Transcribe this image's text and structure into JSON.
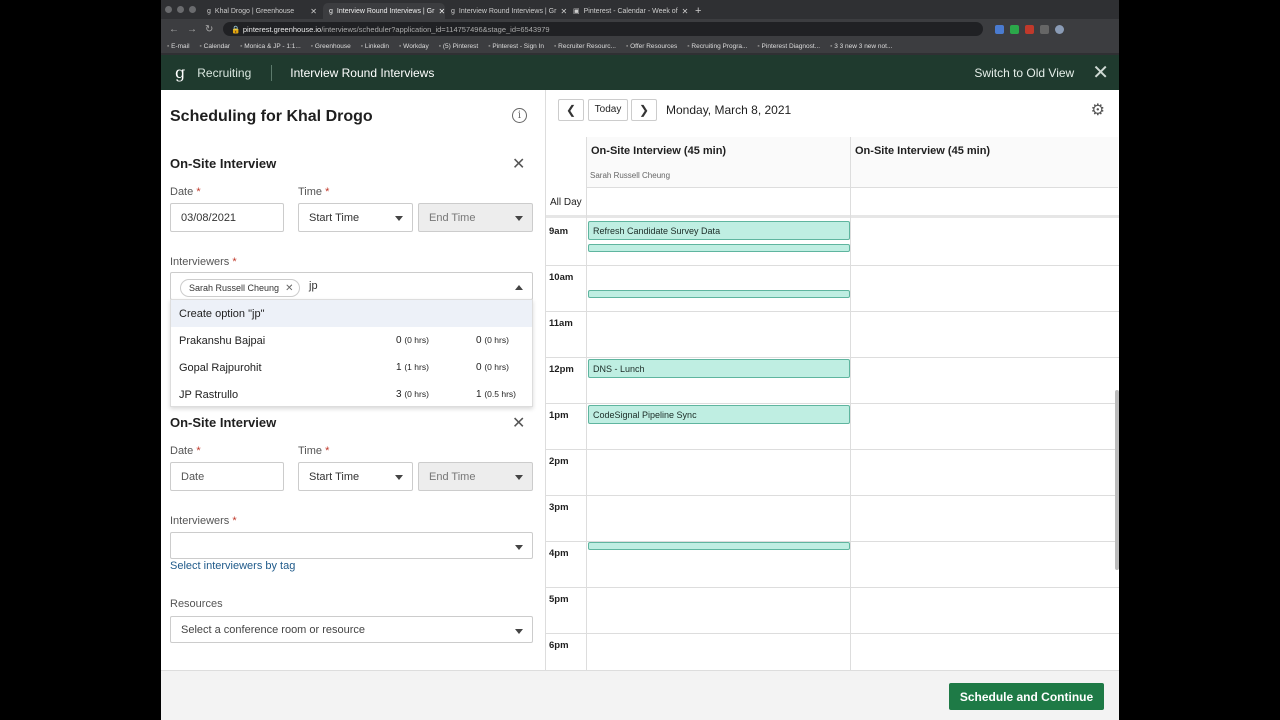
{
  "browser": {
    "tabs": [
      {
        "label": "Khal Drogo | Greenhouse",
        "active": false
      },
      {
        "label": "Interview Round Interviews | Gr",
        "active": true
      },
      {
        "label": "Interview Round Interviews | Gr",
        "active": false
      },
      {
        "label": "Pinterest - Calendar - Week of",
        "active": false
      }
    ],
    "url_host": "pinterest.greenhouse.io",
    "url_path": "/interviews/scheduler?application_id=114757496&stage_id=6543979",
    "bookmarks": [
      "E-mail",
      "Calendar",
      "Monica & JP - 1:1...",
      "Greenhouse",
      "Linkedin",
      "Workday",
      "(5) Pinterest",
      "Pinterest - Sign In",
      "Recruiter Resourc...",
      "Offer Resources",
      "Recruiting Progra...",
      "Pinterest Diagnost...",
      "3 3 new 3 new not..."
    ]
  },
  "header": {
    "app": "Recruiting",
    "title": "Interview Round Interviews",
    "switch_label": "Switch to Old View"
  },
  "scheduler": {
    "title": "Scheduling for Khal Drogo",
    "section1": {
      "heading": "On-Site Interview",
      "date_label": "Date",
      "date_value": "03/08/2021",
      "time_label": "Time",
      "start_placeholder": "Start Time",
      "end_placeholder": "End Time",
      "interviewers_label": "Interviewers",
      "chip": "Sarah Russell Cheung",
      "query": "jp"
    },
    "dropdown": [
      {
        "name": "Create option \"jp\"",
        "a": "",
        "ah": "",
        "b": "",
        "bh": ""
      },
      {
        "name": "Prakanshu Bajpai",
        "a": "0",
        "ah": "(0 hrs)",
        "b": "0",
        "bh": "(0 hrs)"
      },
      {
        "name": "Gopal Rajpurohit",
        "a": "1",
        "ah": "(1 hrs)",
        "b": "0",
        "bh": "(0 hrs)"
      },
      {
        "name": "JP Rastrullo",
        "a": "3",
        "ah": "(0 hrs)",
        "b": "1",
        "bh": "(0.5 hrs)"
      }
    ],
    "section2": {
      "heading": "On-Site Interview",
      "date_label": "Date",
      "date_placeholder": "Date",
      "time_label": "Time",
      "start_placeholder": "Start Time",
      "end_placeholder": "End Time",
      "interviewers_label": "Interviewers",
      "tag_link": "Select interviewers by tag",
      "resources_label": "Resources",
      "resources_placeholder": "Select a conference room or resource"
    },
    "required_mark": "*"
  },
  "calendar": {
    "today_label": "Today",
    "date": "Monday, March 8, 2021",
    "columns": [
      {
        "title": "On-Site Interview (45 min)",
        "subtitle": "Sarah Russell Cheung"
      },
      {
        "title": "On-Site Interview (45 min)",
        "subtitle": ""
      }
    ],
    "all_day": "All Day",
    "hours": [
      "9am",
      "10am",
      "11am",
      "12pm",
      "1pm",
      "2pm",
      "3pm",
      "4pm",
      "5pm",
      "6pm"
    ],
    "events": [
      {
        "title": "Refresh Candidate Survey Data"
      },
      {
        "title": ""
      },
      {
        "title": ""
      },
      {
        "title": "DNS - Lunch"
      },
      {
        "title": "CodeSignal Pipeline Sync"
      },
      {
        "title": ""
      }
    ]
  },
  "footer": {
    "button": "Schedule and Continue"
  },
  "colors": {
    "header_bg": "#1f3a2e",
    "event_bg": "#bfeee2",
    "primary_btn": "#1e7a46",
    "link": "#1f5a8a"
  }
}
